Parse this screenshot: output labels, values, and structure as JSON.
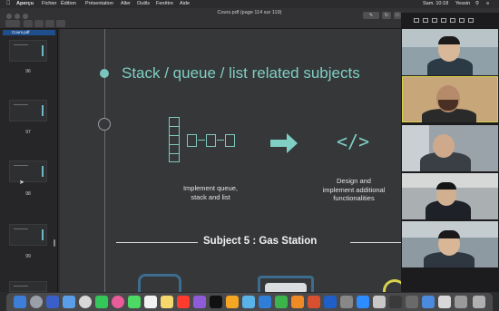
{
  "menubar": {
    "apple_icon": "apple-icon",
    "app_name": "Aperçu",
    "items": [
      "Fichier",
      "Édition",
      "Présentation",
      "Aller",
      "Outils",
      "Fenêtre",
      "Aide"
    ],
    "clock": "Sam. 10:18",
    "user": "Yessin"
  },
  "toolbar": {
    "document_title": "Cours.pdf (page 114 sur 119)"
  },
  "sidebar": {
    "header": "Cours.pdf",
    "pages": [
      "96",
      "97",
      "98",
      "99"
    ]
  },
  "slide": {
    "title": "Stack / queue / list  related subjects",
    "caption_left": [
      "Implement queue,",
      "stack and list"
    ],
    "caption_right": [
      "Design and",
      "implement additional",
      "functionalities"
    ],
    "code_icon_text": "</>",
    "subject_heading": "Subject 5 : Gas Station"
  },
  "colors": {
    "accent": "#7fcfc4",
    "active_speaker": "#d9d24a",
    "selection": "#1f4e8c"
  }
}
